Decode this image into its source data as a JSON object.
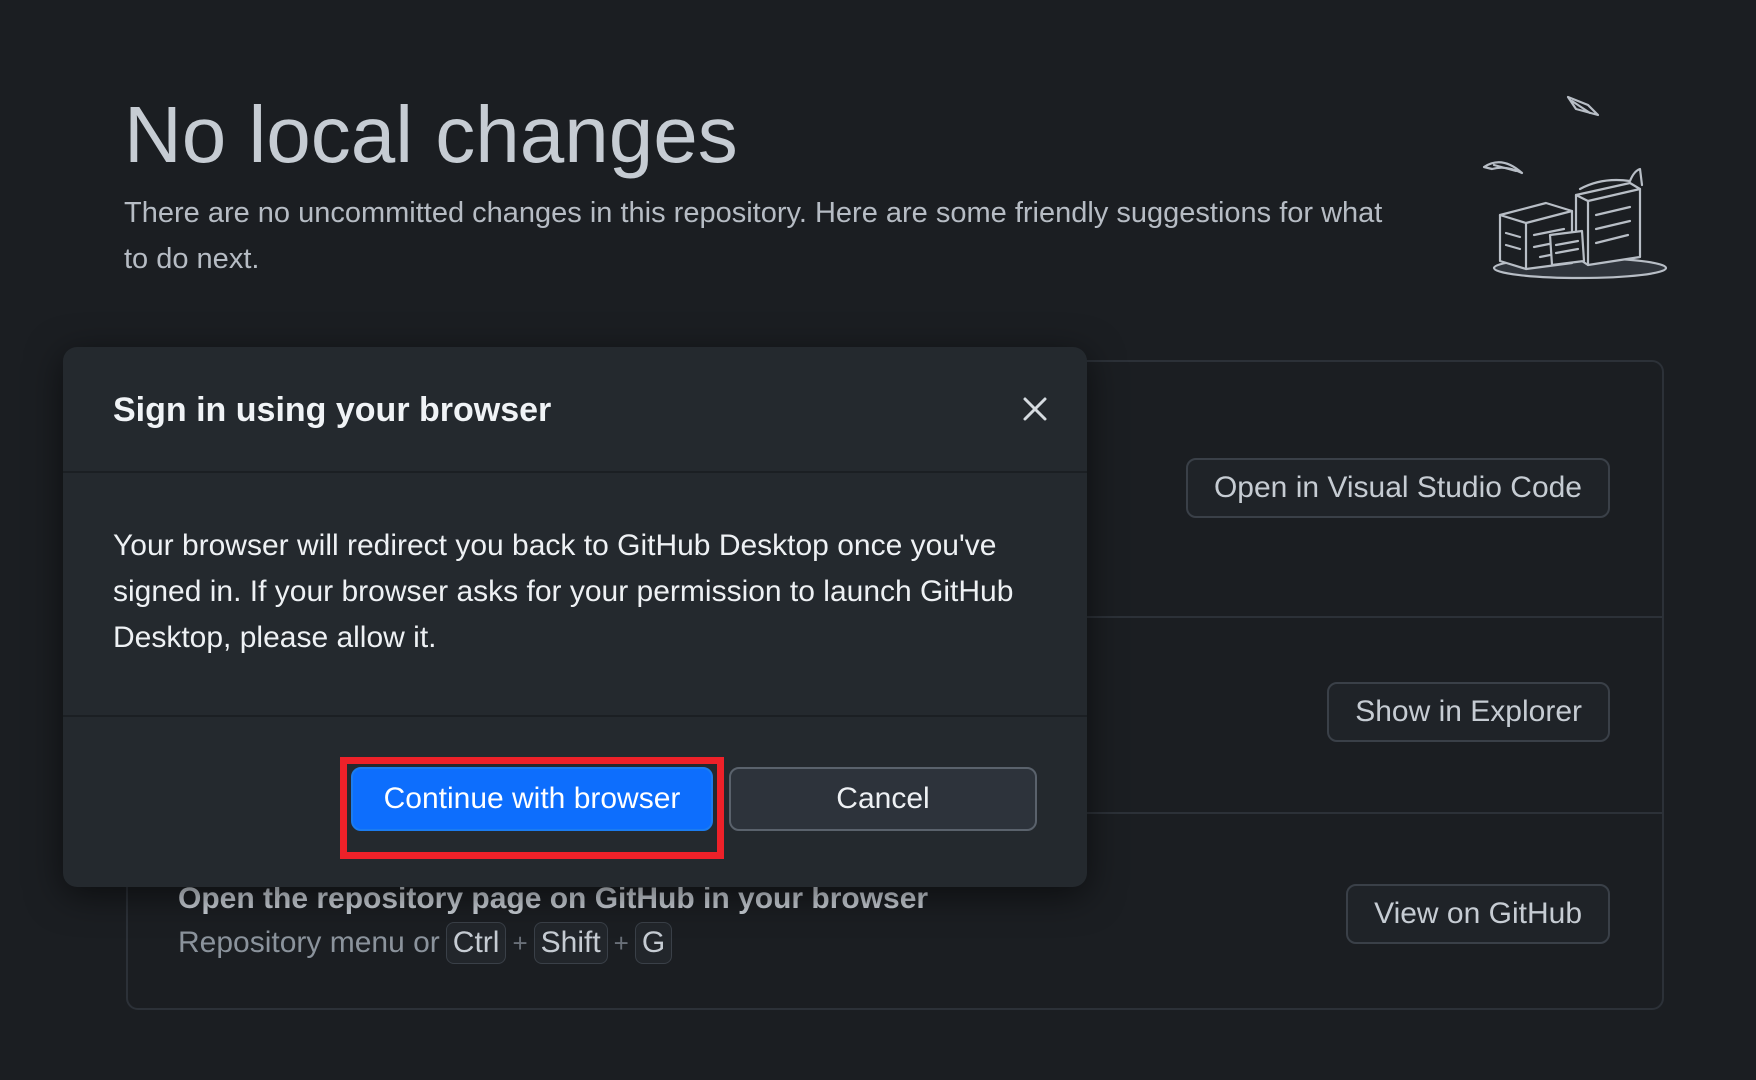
{
  "blank_slate": {
    "title": "No local changes",
    "description": "There are no uncommitted changes in this repository. Here are some friendly suggestions for what to do next."
  },
  "suggestions": [
    {
      "button_label": "Open in Visual Studio Code"
    },
    {
      "button_label": "Show in Explorer"
    },
    {
      "title": "Open the repository page on GitHub in your browser",
      "hint_prefix": "Repository menu or",
      "keys": [
        "Ctrl",
        "Shift",
        "G"
      ],
      "separator": "+",
      "button_label": "View on GitHub"
    }
  ],
  "dialog": {
    "title": "Sign in using your browser",
    "message": "Your browser will redirect you back to GitHub Desktop once you've signed in. If your browser asks for your permission to launch GitHub Desktop, please allow it.",
    "primary_button": "Continue with browser",
    "secondary_button": "Cancel",
    "close_icon": "close-icon"
  },
  "colors": {
    "background": "#1b1e22",
    "dialog_background": "#24292e",
    "primary_button": "#0d6efd",
    "highlight": "#ee2129"
  }
}
